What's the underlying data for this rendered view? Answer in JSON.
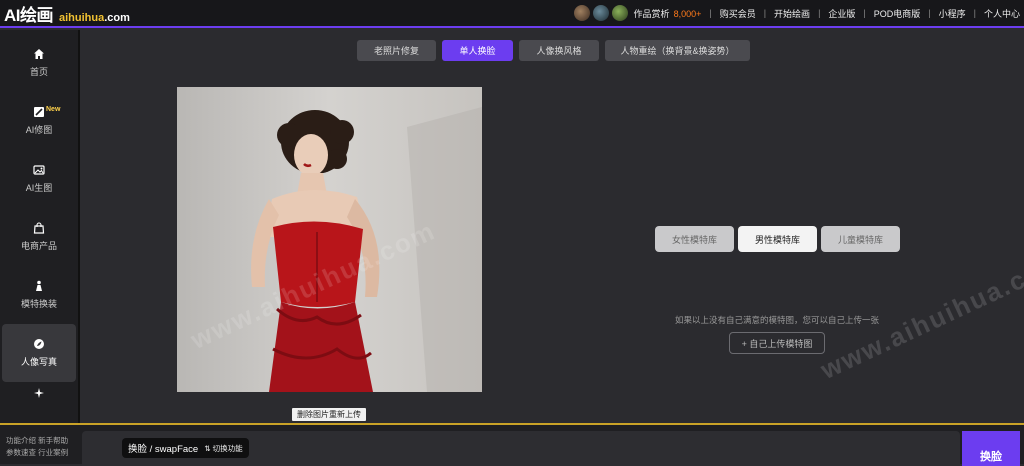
{
  "header": {
    "logo_ai": "AI绘画",
    "logo_domain": "aihuihua",
    "logo_tld": ".com",
    "nav": {
      "works": "作品赏析",
      "works_count": "8,000+",
      "buy": "购买会员",
      "start": "开始绘画",
      "enterprise": "企业版",
      "pod": "POD电商版",
      "miniapp": "小程序",
      "account": "个人中心"
    }
  },
  "sidebar": {
    "items": [
      {
        "label": "首页",
        "icon": "home-icon"
      },
      {
        "label": "AI修图",
        "icon": "edit-image-icon",
        "badge": "New"
      },
      {
        "label": "AI生图",
        "icon": "image-generate-icon"
      },
      {
        "label": "电商产品",
        "icon": "shopping-bag-icon"
      },
      {
        "label": "模特换装",
        "icon": "model-outfit-icon"
      },
      {
        "label": "人像写真",
        "icon": "portrait-icon"
      }
    ]
  },
  "tabs": [
    {
      "label": "老照片修复"
    },
    {
      "label": "单人换脸"
    },
    {
      "label": "人像换风格"
    },
    {
      "label": "人物重绘（换背景&换姿势）"
    }
  ],
  "photo": {
    "remove_label": "删除图片重新上传"
  },
  "library": {
    "tabs": [
      "女性模特库",
      "男性模特库",
      "儿童模特库"
    ],
    "hint": "如果以上没有自己满意的模特图，您可以自己上传一张",
    "upload_label": "+ 自己上传模特图"
  },
  "watermark": "www.aihuihua.com",
  "bottom": {
    "links_line1": "功能介绍 新手帮助",
    "links_line2": "参数速查 行业案例",
    "mode_label": "换脸 / swapFace",
    "switch_label": "⇅ 切换功能",
    "swap_button": "换脸"
  },
  "colors": {
    "accent": "#6c3df0",
    "count": "#ff7a1a",
    "logo_domain": "#f1c232"
  }
}
